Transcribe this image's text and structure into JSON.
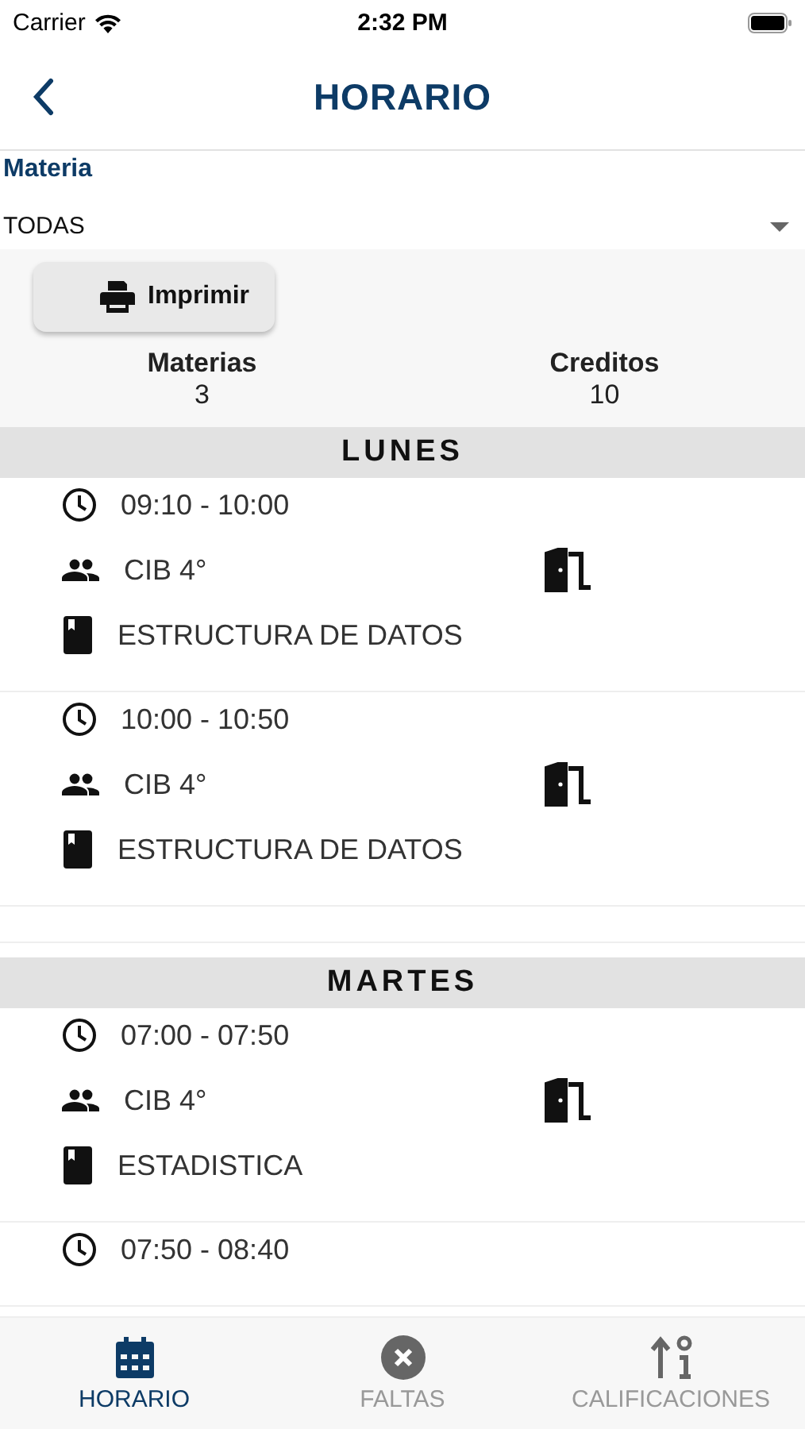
{
  "status_bar": {
    "carrier": "Carrier",
    "time": "2:32 PM"
  },
  "nav": {
    "title": "HORARIO"
  },
  "filter": {
    "label": "Materia",
    "value": "TODAS"
  },
  "print_button": "Imprimir",
  "stats": [
    {
      "label": "Materias",
      "value": "3"
    },
    {
      "label": "Creditos",
      "value": "10"
    }
  ],
  "days": [
    {
      "name": "LUNES",
      "classes": [
        {
          "time": "09:10 - 10:00",
          "group": "CIB 4°",
          "subject": "ESTRUCTURA DE DATOS"
        },
        {
          "time": "10:00 - 10:50",
          "group": "CIB 4°",
          "subject": "ESTRUCTURA DE DATOS"
        }
      ]
    },
    {
      "name": "MARTES",
      "classes": [
        {
          "time": "07:00 - 07:50",
          "group": "CIB 4°",
          "subject": "ESTADISTICA"
        },
        {
          "time": "07:50 - 08:40"
        }
      ]
    }
  ],
  "tab_bar": [
    {
      "label": "HORARIO",
      "selected": true
    },
    {
      "label": "FALTAS",
      "selected": false
    },
    {
      "label": "CALIFICACIONES",
      "selected": false
    }
  ]
}
